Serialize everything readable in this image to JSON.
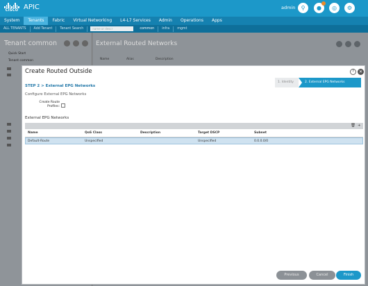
{
  "header": {
    "logo_text": "CISCO",
    "app_title": "APIC",
    "username": "admin"
  },
  "main_nav": [
    "System",
    "Tenants",
    "Fabric",
    "Virtual Networking",
    "L4-L7 Services",
    "Admin",
    "Operations",
    "Apps"
  ],
  "active_nav": "Tenants",
  "sub_nav": {
    "items": [
      "ALL TENANTS",
      "Add Tenant",
      "Tenant Search"
    ],
    "search_placeholder": "name or descr",
    "trail": [
      "common",
      "infra",
      "mgmt"
    ]
  },
  "left_pane": {
    "title": "Tenant common",
    "quick_start": "Quick Start",
    "tree_root": "Tenant common"
  },
  "right_pane": {
    "title": "External Routed Networks",
    "columns": [
      "Name",
      "Alias",
      "Description"
    ]
  },
  "modal": {
    "title": "Create Routed Outside",
    "steps": [
      "1. Identity",
      "2. External EPG Networks"
    ],
    "active_step": 2,
    "step_label": "STEP 2 > External EPG Networks",
    "section_title": "Configure External EPG Networks",
    "route_profiles_label": "Create Route Profiles:",
    "route_profiles_checked": false,
    "table_title": "External EPG Networks",
    "table": {
      "columns": [
        "Name",
        "QoS Class",
        "Description",
        "Target DSCP",
        "Subnet"
      ],
      "rows": [
        {
          "name": "Default-Route",
          "qos": "Unspecified",
          "description": "",
          "dscp": "Unspecified",
          "subnet": "0.0.0.0/0"
        }
      ]
    },
    "buttons": {
      "previous": "Previous",
      "cancel": "Cancel",
      "finish": "Finish"
    }
  },
  "colors": {
    "accent": "#1c98c9",
    "selected_row": "#cfe2f0"
  }
}
